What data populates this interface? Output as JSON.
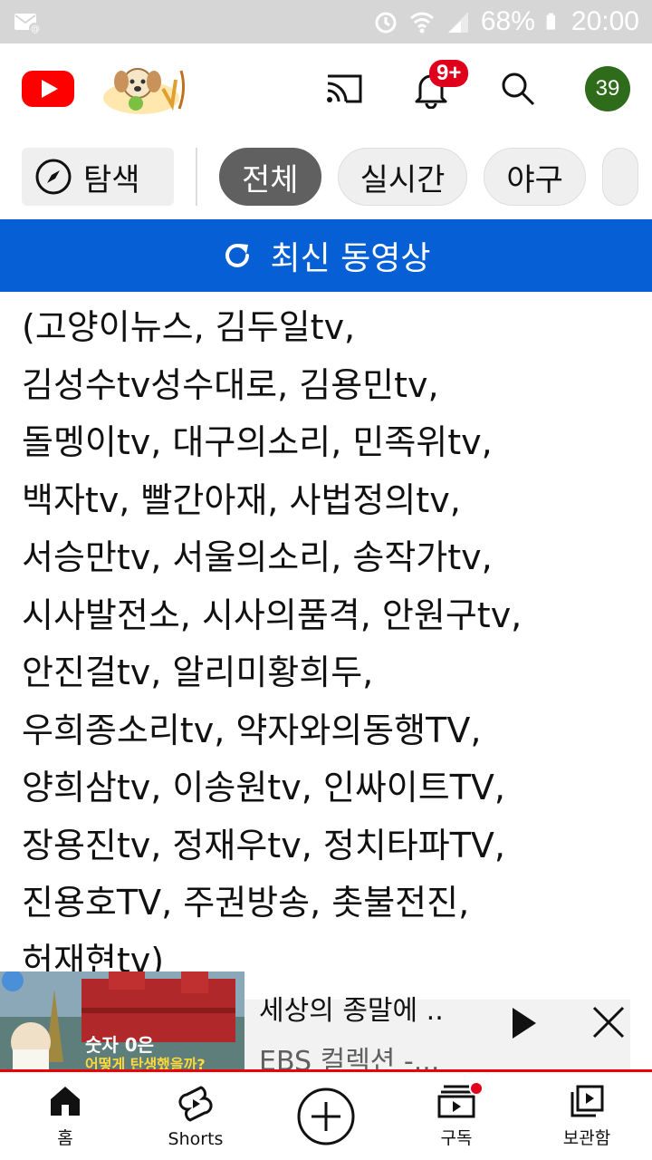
{
  "status_bar": {
    "battery": "68%",
    "time": "20:00"
  },
  "header": {
    "notification_count": "9+",
    "avatar_text": "39"
  },
  "chips": {
    "explore_label": "탐색",
    "items": [
      "전체",
      "실시간",
      "야구"
    ],
    "active_index": 0
  },
  "banner": {
    "label": "최신 동영상"
  },
  "content": {
    "lines": [
      "(고양이뉴스, 김두일tv,",
      "김성수tv성수대로, 김용민tv,",
      "돌멩이tv, 대구의소리, 민족위tv,",
      "백자tv, 빨간아재, 사법정의tv,",
      "서승만tv, 서울의소리, 송작가tv,",
      "시사발전소, 시사의품격, 안원구tv,",
      "안진걸tv, 알리미황희두,",
      "우희종소리tv, 약자와의동행TV,",
      "양희삼tv,  이송원tv,  인싸이트TV,",
      "장용진tv, 정재우tv, 정치타파TV,",
      "진용호TV, 주권방송, 촛불전진,",
      "허재현tv)"
    ]
  },
  "mini_player": {
    "title": "세상의 종말에 ..",
    "channel": "EBS 컬렉션 -...",
    "thumb_caption_1": "숫자 0은",
    "thumb_caption_2": "어떻게 탄생했을까?",
    "progress": 1.0
  },
  "bottom_nav": {
    "items": [
      {
        "label": "홈",
        "icon": "home-icon"
      },
      {
        "label": "Shorts",
        "icon": "shorts-icon"
      },
      {
        "label": "",
        "icon": "add-icon"
      },
      {
        "label": "구독",
        "icon": "subscriptions-icon"
      },
      {
        "label": "보관함",
        "icon": "library-icon"
      }
    ]
  },
  "colors": {
    "brand_red": "#ff0000",
    "banner_blue": "#065fd4",
    "active_chip": "#606060",
    "avatar_green": "#2e6b1a"
  }
}
